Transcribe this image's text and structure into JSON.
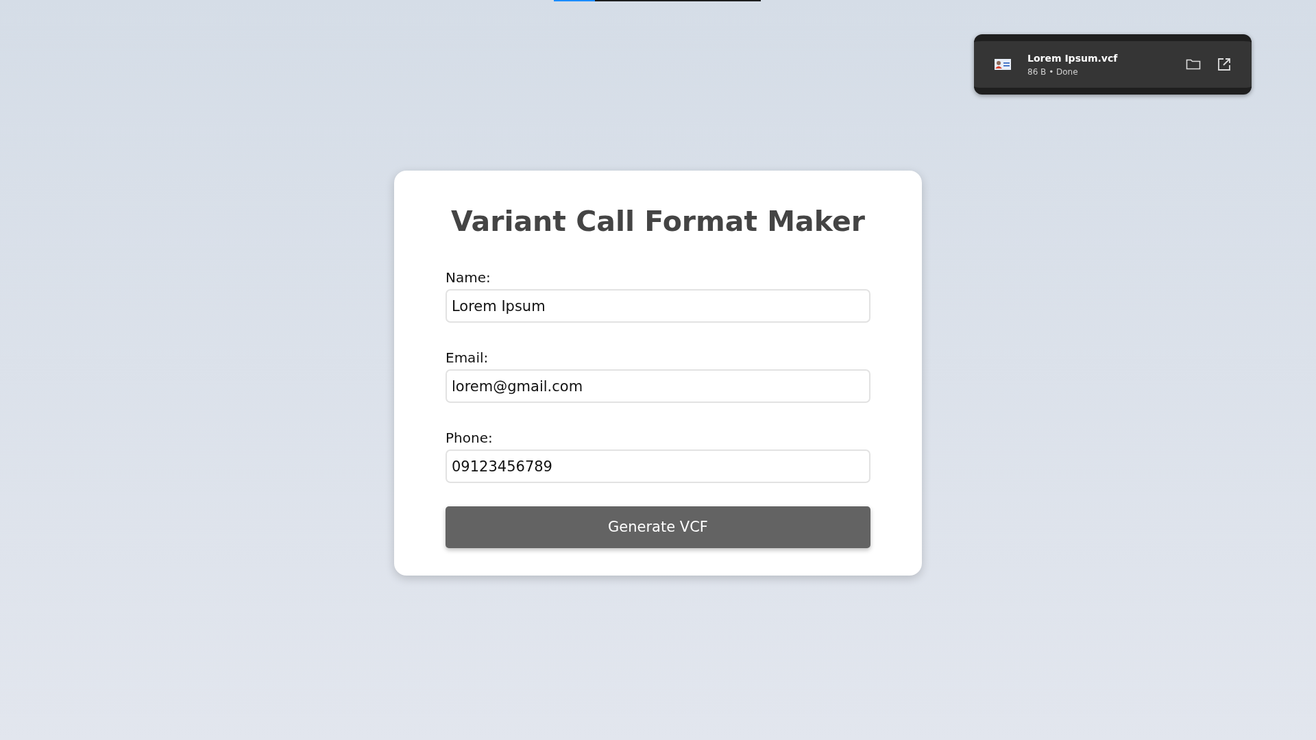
{
  "top_progress": {
    "level": 0.2
  },
  "download": {
    "file_name": "Lorem Ipsum.vcf",
    "status": "86 B • Done"
  },
  "form": {
    "title": "Variant Call Format Maker",
    "fields": [
      {
        "label": "Name:",
        "value": "Lorem Ipsum"
      },
      {
        "label": "Email:",
        "value": "lorem@gmail.com"
      },
      {
        "label": "Phone:",
        "value": "09123456789"
      }
    ],
    "button": "Generate VCF"
  }
}
